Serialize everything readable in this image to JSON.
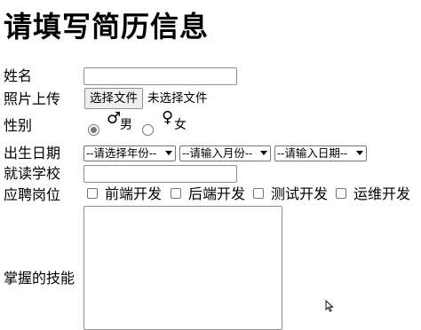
{
  "form": {
    "title": "请填写简历信息",
    "name": {
      "label": "姓名",
      "value": "",
      "placeholder": ""
    },
    "photo": {
      "label": "照片上传",
      "button_label": "选择文件",
      "status": "未选择文件"
    },
    "gender": {
      "label": "性别",
      "options": [
        {
          "symbol": "♂",
          "text": "男",
          "selected": true
        },
        {
          "symbol": "♀",
          "text": "女",
          "selected": false
        }
      ]
    },
    "birthdate": {
      "label": "出生日期",
      "year_selected": "--请选择年份--",
      "month_selected": "--请输入月份--",
      "day_selected": "--请输入日期--"
    },
    "school": {
      "label": "就读学校",
      "value": "",
      "placeholder": ""
    },
    "position": {
      "label": "应聘岗位",
      "options": [
        {
          "label": "前端开发",
          "checked": false
        },
        {
          "label": "后端开发",
          "checked": false
        },
        {
          "label": "测试开发",
          "checked": false
        },
        {
          "label": "运维开发",
          "checked": false
        }
      ]
    },
    "skills": {
      "label": "掌握的技能",
      "value": ""
    }
  }
}
